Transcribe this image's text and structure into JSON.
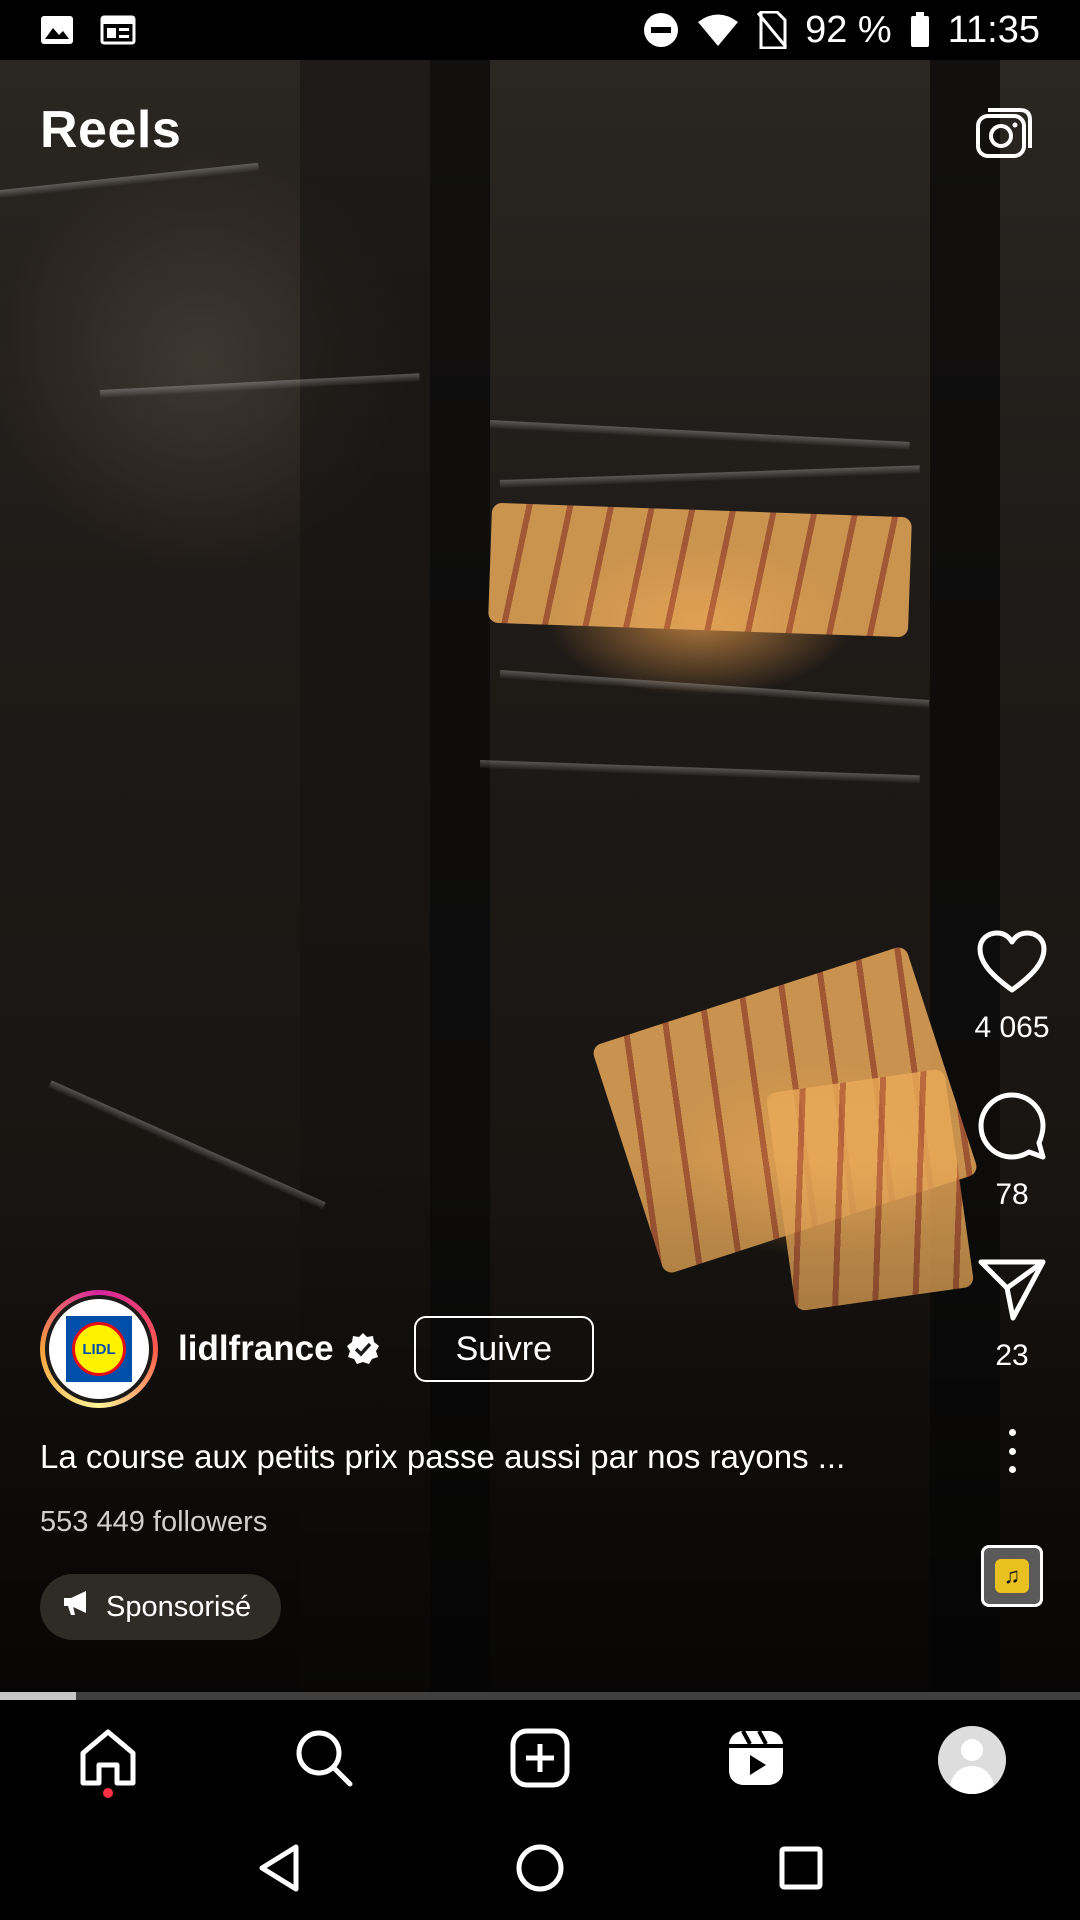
{
  "status_bar": {
    "battery": "92 %",
    "time": "11:35",
    "left_icons": [
      "image-icon",
      "news-icon"
    ],
    "right_icons": [
      "dnd-icon",
      "wifi-icon",
      "no-sim-icon",
      "battery-icon"
    ]
  },
  "header": {
    "title": "Reels",
    "camera_icon": "camera-icon"
  },
  "actions": {
    "like_count": "4 065",
    "comment_count": "78",
    "share_count": "23"
  },
  "post": {
    "username": "lidlfrance",
    "logo_text": "LIDL",
    "follow_label": "Suivre",
    "caption": "La course aux petits prix passe aussi par nos rayons ...",
    "followers": "553 449 followers",
    "sponsored_label": "Sponsorisé",
    "progress": 0.07
  },
  "bottom_nav": [
    "home-icon",
    "search-icon",
    "create-icon",
    "reels-icon",
    "profile-avatar"
  ],
  "system_nav": [
    "back-button",
    "home-button",
    "recents-button"
  ],
  "colors": {
    "background": "#000000",
    "notification_dot": "#ff3040",
    "lidl_blue": "#0050aa",
    "lidl_yellow": "#fff200",
    "lidl_red": "#e60a14"
  }
}
